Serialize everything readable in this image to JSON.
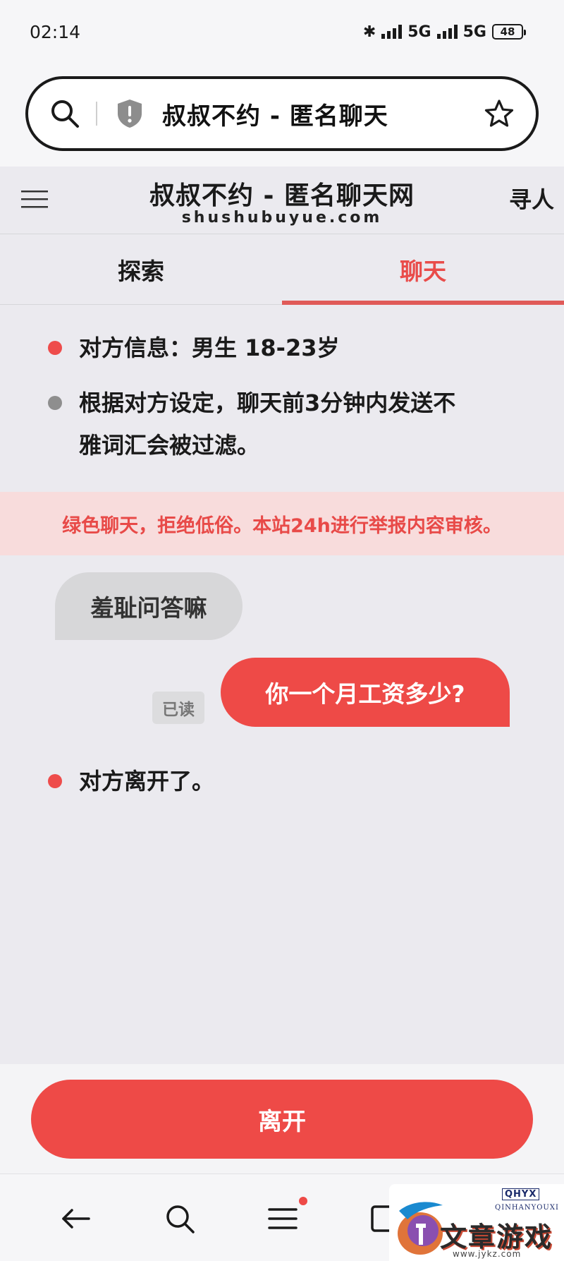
{
  "status_bar": {
    "time": "02:14",
    "bluetooth_glyph": "✱",
    "network_1": "5G",
    "network_2": "5G",
    "battery": "48"
  },
  "browser": {
    "url_title": "叔叔不约 - 匿名聊天",
    "icons": [
      "search-icon",
      "shield-icon",
      "star-icon"
    ]
  },
  "site_header": {
    "title": "叔叔不约 - 匿名聊天网",
    "url": "shushubuyue.com",
    "find_people": "寻人"
  },
  "tabs": [
    {
      "label": "探索",
      "active": false
    },
    {
      "label": "聊天",
      "active": true
    }
  ],
  "info": {
    "partner_info": "对方信息：男生  18-23岁",
    "filter_notice_line1": "根据对方设定，聊天前3分钟内发送不",
    "filter_notice_line2": "雅词汇会被过滤。"
  },
  "notice_banner": "绿色聊天，拒绝低俗。本站24h进行举报内容审核。",
  "messages": [
    {
      "direction": "incoming",
      "text": "羞耻问答嘛"
    },
    {
      "direction": "outgoing",
      "text": "你一个月工资多少?",
      "status": "已读"
    }
  ],
  "system_message": "对方离开了。",
  "leave_button": "离开",
  "bottom_nav": {
    "icons": [
      "back-arrow-icon",
      "search-icon",
      "menu-icon",
      "tabs-icon"
    ],
    "menu_has_badge": true
  },
  "watermark": {
    "badge": "QHYX",
    "sub": "QINHANYOUXI",
    "text": "文章游戏网",
    "url": "www.jykz.com"
  },
  "colors": {
    "accent": "#ee4a47",
    "background": "#ebeaef",
    "banner_bg": "#f8dcdc"
  }
}
